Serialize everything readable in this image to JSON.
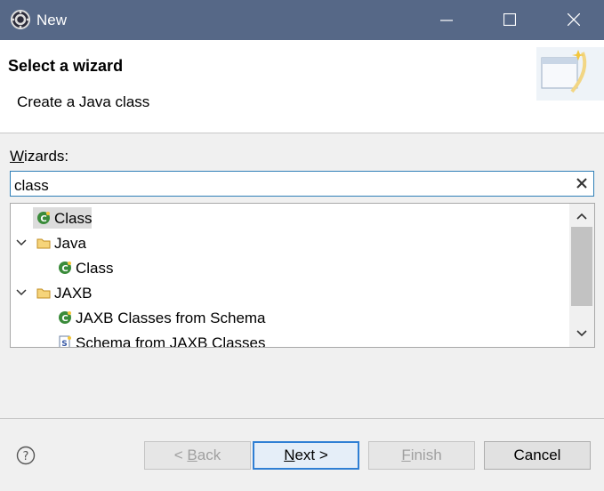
{
  "window": {
    "title": "New"
  },
  "header": {
    "heading": "Select a wizard",
    "description": "Create a Java class"
  },
  "wizards": {
    "label_underlined": "W",
    "label_rest": "izards:",
    "filter_value": "class"
  },
  "tree": {
    "items": [
      {
        "label": "Class",
        "icon": "java-class-icon",
        "selected": true
      },
      {
        "label": "Java",
        "icon": "folder-icon",
        "expanded": true
      },
      {
        "label": "Class",
        "icon": "java-class-icon"
      },
      {
        "label": "JAXB",
        "icon": "folder-icon",
        "expanded": true
      },
      {
        "label": "JAXB Classes from Schema",
        "icon": "java-class-icon"
      },
      {
        "label": "Schema from JAXB Classes",
        "icon": "schema-file-icon"
      }
    ]
  },
  "buttons": {
    "back_prefix": "< ",
    "back_underlined": "B",
    "back_rest": "ack",
    "next_underlined": "N",
    "next_rest": "ext >",
    "finish_underlined": "F",
    "finish_rest": "inish",
    "cancel": "Cancel"
  },
  "colors": {
    "titlebar": "#566887",
    "focus": "#2f7fb7",
    "folder": "#e8b44c",
    "class_icon": "#3a8b3a"
  }
}
